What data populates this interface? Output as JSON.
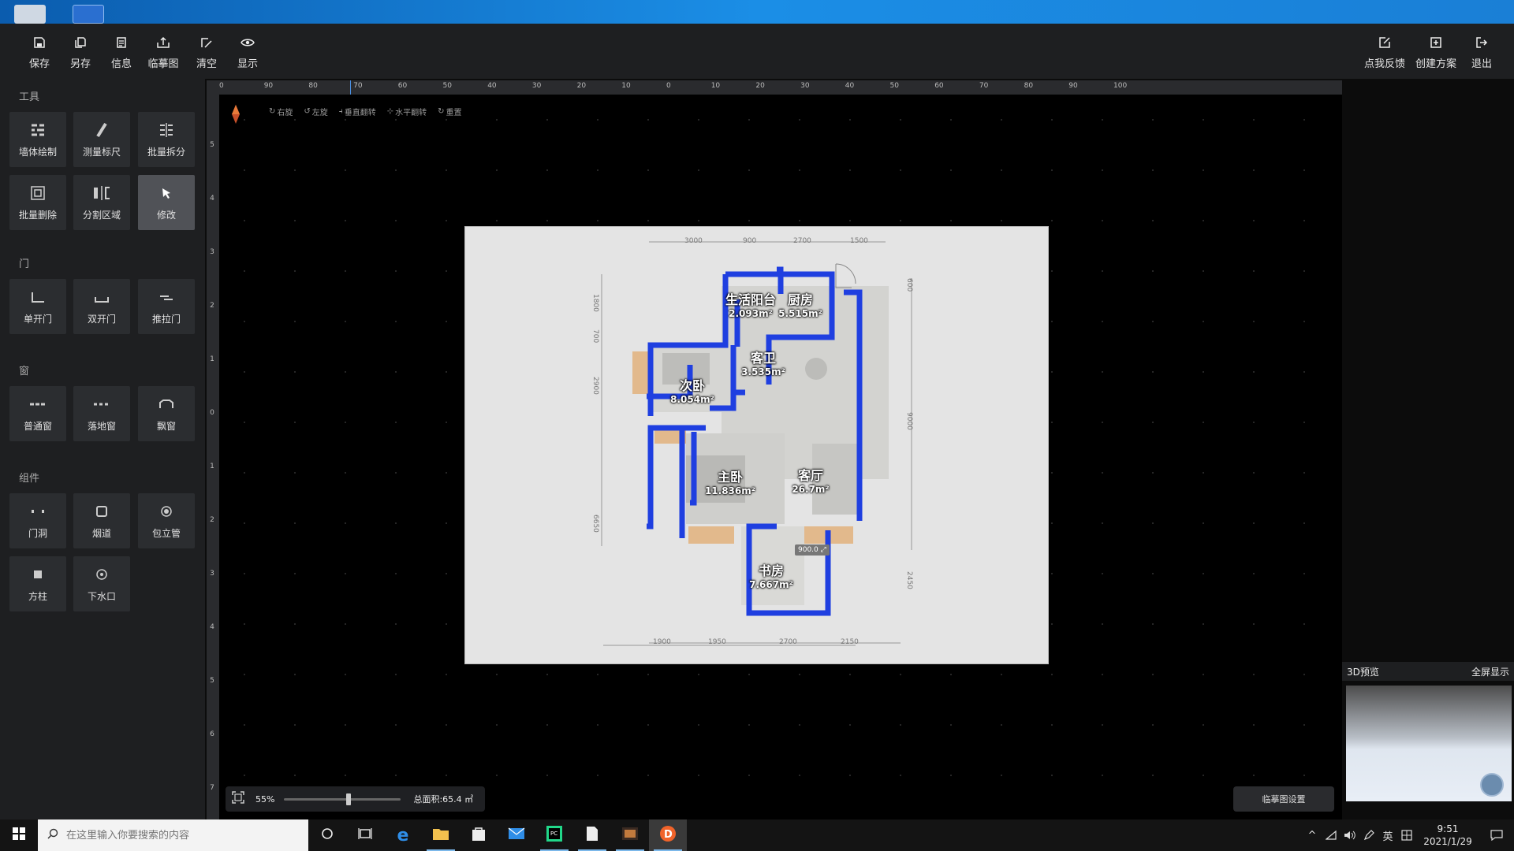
{
  "toolbar": {
    "left": [
      {
        "label": "保存",
        "icon": "save-icon"
      },
      {
        "label": "另存",
        "icon": "save-as-icon"
      },
      {
        "label": "信息",
        "icon": "info-icon"
      },
      {
        "label": "临摹图",
        "icon": "trace-image-icon"
      },
      {
        "label": "清空",
        "icon": "clear-icon"
      },
      {
        "label": "显示",
        "icon": "eye-icon"
      }
    ],
    "right": [
      {
        "label": "点我反馈",
        "icon": "feedback-icon"
      },
      {
        "label": "创建方案",
        "icon": "create-plan-icon"
      },
      {
        "label": "退出",
        "icon": "exit-icon"
      }
    ]
  },
  "sidebar": {
    "sections": [
      {
        "title": "工具",
        "items": [
          {
            "label": "墙体绘制",
            "icon": "wall-draw-icon"
          },
          {
            "label": "测量标尺",
            "icon": "ruler-icon"
          },
          {
            "label": "批量拆分",
            "icon": "batch-split-icon"
          },
          {
            "label": "批量删除",
            "icon": "batch-delete-icon"
          },
          {
            "label": "分割区域",
            "icon": "split-area-icon"
          },
          {
            "label": "修改",
            "icon": "cursor-icon",
            "active": true
          }
        ]
      },
      {
        "title": "门",
        "items": [
          {
            "label": "单开门",
            "icon": "single-door-icon"
          },
          {
            "label": "双开门",
            "icon": "double-door-icon"
          },
          {
            "label": "推拉门",
            "icon": "sliding-door-icon"
          }
        ]
      },
      {
        "title": "窗",
        "items": [
          {
            "label": "普通窗",
            "icon": "window-icon"
          },
          {
            "label": "落地窗",
            "icon": "floor-window-icon"
          },
          {
            "label": "飘窗",
            "icon": "bay-window-icon"
          }
        ]
      },
      {
        "title": "组件",
        "items": [
          {
            "label": "门洞",
            "icon": "door-opening-icon"
          },
          {
            "label": "烟道",
            "icon": "flue-icon"
          },
          {
            "label": "包立管",
            "icon": "pipe-icon"
          },
          {
            "label": "方柱",
            "icon": "column-icon"
          },
          {
            "label": "下水口",
            "icon": "drain-icon"
          }
        ]
      }
    ]
  },
  "ruler": {
    "h_labels": [
      "0",
      "90",
      "80",
      "70",
      "60",
      "50",
      "40",
      "30",
      "20",
      "10",
      "0",
      "10",
      "20",
      "30",
      "40",
      "50",
      "60",
      "70",
      "80",
      "90",
      "100"
    ],
    "v_labels": [
      "5",
      "4",
      "3",
      "2",
      "1",
      "0",
      "1",
      "2",
      "3",
      "4",
      "5",
      "6",
      "7"
    ]
  },
  "canvas_tools": [
    {
      "label": "右旋",
      "icon": "rotate-right-icon"
    },
    {
      "label": "左旋",
      "icon": "rotate-left-icon"
    },
    {
      "label": "垂直翻转",
      "icon": "flip-vertical-icon"
    },
    {
      "label": "水平翻转",
      "icon": "flip-horizontal-icon"
    },
    {
      "label": "重置",
      "icon": "reset-icon"
    }
  ],
  "plan": {
    "rooms": [
      {
        "name": "生活阳台",
        "area": "2.093m²"
      },
      {
        "name": "厨房",
        "area": "5.515m²"
      },
      {
        "name": "客卫",
        "area": "3.535m²"
      },
      {
        "name": "次卧",
        "area": "8.054m²"
      },
      {
        "name": "主卧",
        "area": "11.836m²"
      },
      {
        "name": "客厅",
        "area": "26.7m²"
      },
      {
        "name": "书房",
        "area": "7.667m²"
      }
    ],
    "top_dims": [
      "3000",
      "900",
      "2700",
      "1500"
    ],
    "bottom_dims": [
      "1900",
      "1950",
      "2700",
      "2150"
    ],
    "left_dims": [
      "1800",
      "700",
      "2900",
      "6650"
    ],
    "right_dims": [
      "600",
      "9000",
      "2450"
    ],
    "door_width": "900.0"
  },
  "zoom": {
    "percent": "55%",
    "level": 0.55,
    "total_area": "总面积:65.4 ㎡"
  },
  "trace_settings": "临摹图设置",
  "preview": {
    "title": "3D预览",
    "fullscreen": "全屏显示"
  },
  "taskbar": {
    "search_placeholder": "在这里输入你要搜索的内容",
    "ime": "英",
    "time": "9:51",
    "date": "2021/1/29"
  }
}
